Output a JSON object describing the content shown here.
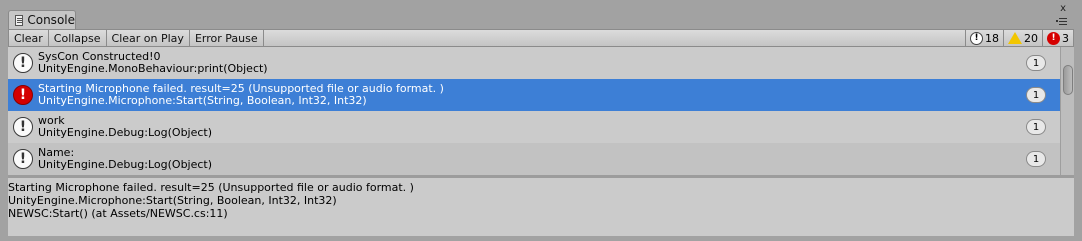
{
  "window": {
    "tab_label": "Console",
    "close_glyph": "x"
  },
  "toolbar": {
    "clear": "Clear",
    "collapse": "Collapse",
    "clear_on_play": "Clear on Play",
    "error_pause": "Error Pause",
    "info_count": "18",
    "warning_count": "20",
    "error_count": "3"
  },
  "logs": [
    {
      "type": "info",
      "line1": "SysCon Constructed!0",
      "line2": "UnityEngine.MonoBehaviour:print(Object)",
      "count": "1",
      "selected": false
    },
    {
      "type": "error",
      "line1": "Starting Microphone failed. result=25 (Unsupported file or audio format. )",
      "line2": "UnityEngine.Microphone:Start(String, Boolean, Int32, Int32)",
      "count": "1",
      "selected": true
    },
    {
      "type": "info",
      "line1": "work",
      "line2": "UnityEngine.Debug:Log(Object)",
      "count": "1",
      "selected": false
    },
    {
      "type": "info",
      "line1": "Name:",
      "line2": "UnityEngine.Debug:Log(Object)",
      "count": "1",
      "selected": false
    }
  ],
  "detail": {
    "lines": [
      "Starting Microphone failed. result=25 (Unsupported file or audio format. )",
      "UnityEngine.Microphone:Start(String, Boolean, Int32, Int32)",
      "NEWSC:Start() (at Assets/NEWSC.cs:11)"
    ]
  },
  "colors": {
    "selected": "#3d7fd6",
    "error": "#d40000",
    "warning": "#f2c600"
  },
  "icons": {
    "info": "info-icon",
    "warning": "warning-icon",
    "error": "error-icon"
  }
}
